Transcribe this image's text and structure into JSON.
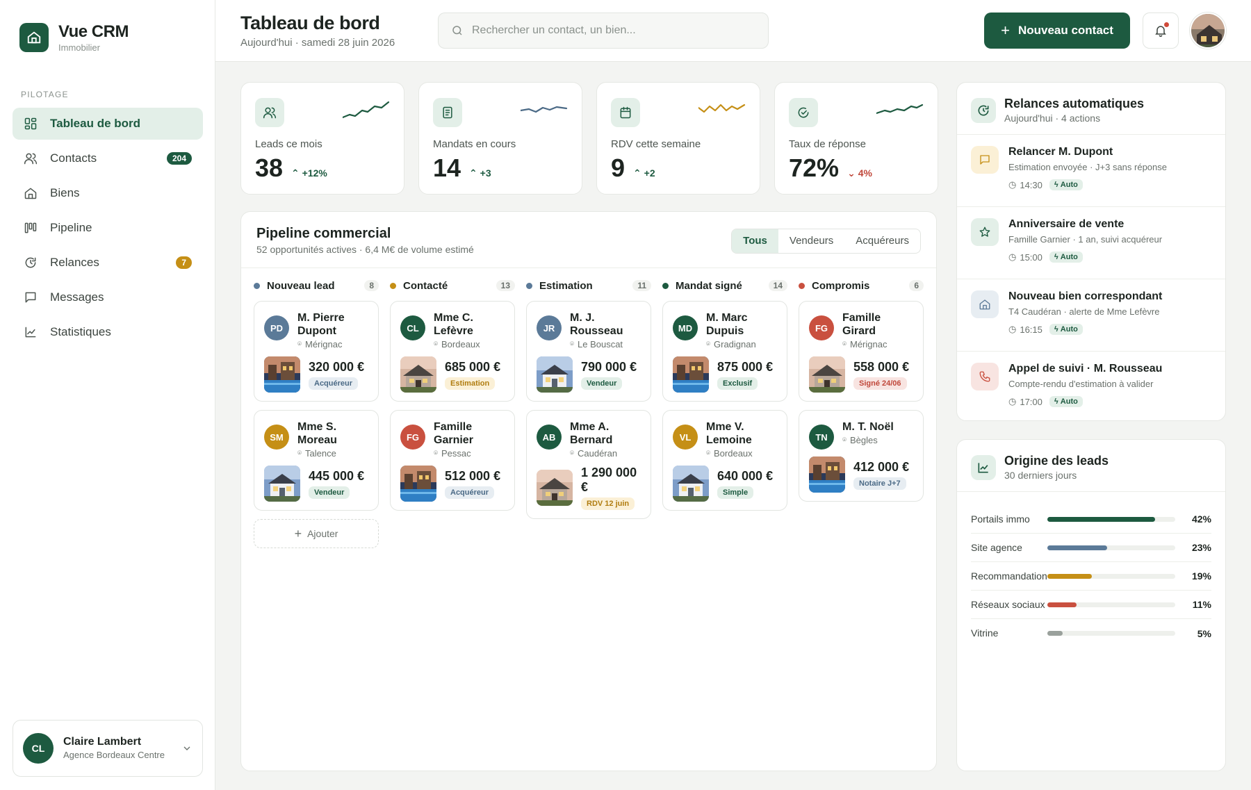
{
  "app": {
    "title": "Vue CRM",
    "subtitle": "Immobilier",
    "brand_color": "#1d5a40"
  },
  "sidebar": {
    "section": "PILOTAGE",
    "items": [
      {
        "label": "Tableau de bord",
        "icon": "dashboard-icon",
        "active": true
      },
      {
        "label": "Contacts",
        "icon": "users-icon",
        "badge": "204"
      },
      {
        "label": "Biens",
        "icon": "home-icon"
      },
      {
        "label": "Pipeline",
        "icon": "pipeline-icon"
      },
      {
        "label": "Relances",
        "icon": "clock-icon",
        "badge": "7"
      },
      {
        "label": "Messages",
        "icon": "message-icon"
      },
      {
        "label": "Statistiques",
        "icon": "chart-icon"
      }
    ],
    "user": {
      "initials": "CL",
      "name": "Claire Lambert",
      "org": "Agence Bordeaux Centre"
    }
  },
  "header": {
    "title": "Tableau de bord",
    "date": "Aujourd'hui · samedi 28 juin 2026",
    "search_placeholder": "Rechercher un contact, un bien...",
    "new_contact": "Nouveau contact"
  },
  "kpis": [
    {
      "label": "Leads ce mois",
      "value": "38",
      "delta": "+12%",
      "trend": "up",
      "icon": "users-icon",
      "spark_color": "#1d5a40"
    },
    {
      "label": "Mandats en cours",
      "value": "14",
      "delta": "+3",
      "trend": "up",
      "icon": "document-icon",
      "spark_color": "#4b6a86"
    },
    {
      "label": "RDV cette semaine",
      "value": "9",
      "delta": "+2",
      "trend": "up",
      "icon": "calendar-icon",
      "spark_color": "#c58f16"
    },
    {
      "label": "Taux de réponse",
      "value": "72%",
      "delta": "4%",
      "trend": "down",
      "icon": "check-circle-icon",
      "spark_color": "#1d5a40"
    }
  ],
  "pipeline": {
    "title": "Pipeline commercial",
    "subtitle": "52 opportunités actives · 6,4 M€ de volume estimé",
    "tabs": [
      "Tous",
      "Vendeurs",
      "Acquéreurs"
    ],
    "add_label": "Ajouter",
    "columns": [
      {
        "name": "Nouveau lead",
        "count": "8",
        "color": "#5b7a98",
        "deals": [
          {
            "initials": "PD",
            "av": "#5b7a98",
            "name": "M. Pierre Dupont",
            "loc": "Mérignac",
            "price": "320 000 €",
            "tag": "Acquéreur",
            "tag_style": "blue",
            "photo": "pool"
          },
          {
            "initials": "SM",
            "av": "#c58f16",
            "name": "Mme S. Moreau",
            "loc": "Talence",
            "price": "445 000 €",
            "tag": "Vendeur",
            "tag_style": "green",
            "photo": "house"
          }
        ]
      },
      {
        "name": "Contacté",
        "count": "13",
        "color": "#c58f16",
        "deals": [
          {
            "initials": "CL",
            "av": "#1d5a40",
            "name": "Mme C. Lefèvre",
            "loc": "Bordeaux",
            "price": "685 000 €",
            "tag": "Estimation",
            "tag_style": "amber",
            "photo": "house2"
          },
          {
            "initials": "FG",
            "av": "#c9503f",
            "name": "Famille Garnier",
            "loc": "Pessac",
            "price": "512 000 €",
            "tag": "Acquéreur",
            "tag_style": "blue",
            "photo": "pool"
          }
        ]
      },
      {
        "name": "Estimation",
        "count": "11",
        "color": "#5b7a98",
        "deals": [
          {
            "initials": "JR",
            "av": "#5b7a98",
            "name": "M. J. Rousseau",
            "loc": "Le Bouscat",
            "price": "790 000 €",
            "tag": "Vendeur",
            "tag_style": "green",
            "photo": "house"
          },
          {
            "initials": "AB",
            "av": "#1d5a40",
            "name": "Mme A. Bernard",
            "loc": "Caudéran",
            "price": "1 290 000 €",
            "tag": "RDV 12 juin",
            "tag_style": "amber",
            "photo": "house2"
          }
        ]
      },
      {
        "name": "Mandat signé",
        "count": "14",
        "color": "#1d5a40",
        "deals": [
          {
            "initials": "MD",
            "av": "#1d5a40",
            "name": "M. Marc Dupuis",
            "loc": "Gradignan",
            "price": "875 000 €",
            "tag": "Exclusif",
            "tag_style": "green",
            "photo": "pool"
          },
          {
            "initials": "VL",
            "av": "#c58f16",
            "name": "Mme V. Lemoine",
            "loc": "Bordeaux",
            "price": "640 000 €",
            "tag": "Simple",
            "tag_style": "green",
            "photo": "house"
          }
        ]
      },
      {
        "name": "Compromis",
        "count": "6",
        "color": "#c9503f",
        "deals": [
          {
            "initials": "FG",
            "av": "#c9503f",
            "name": "Famille Girard",
            "loc": "Mérignac",
            "price": "558 000 €",
            "tag": "Signé 24/06",
            "tag_style": "red",
            "photo": "house2"
          },
          {
            "initials": "TN",
            "av": "#1d5a40",
            "name": "M. T. Noël",
            "loc": "Bègles",
            "price": "412 000 €",
            "tag": "Notaire J+7",
            "tag_style": "blue",
            "photo": "pool"
          }
        ]
      }
    ]
  },
  "relances": {
    "title": "Relances automatiques",
    "subtitle": "Aujourd'hui · 4 actions",
    "items": [
      {
        "title": "Relancer M. Dupont",
        "desc": "Estimation envoyée · J+3 sans réponse",
        "time": "14:30",
        "badge": "Auto",
        "icon": "message-icon",
        "bg": "#fbf0d6",
        "fg": "#c58f16"
      },
      {
        "title": "Anniversaire de vente",
        "desc": "Famille Garnier · 1 an, suivi acquéreur",
        "time": "15:00",
        "badge": "Auto",
        "icon": "star-icon",
        "bg": "#e3efe8",
        "fg": "#1d5a40"
      },
      {
        "title": "Nouveau bien correspondant",
        "desc": "T4 Caudéran · alerte de Mme Lefèvre",
        "time": "16:15",
        "badge": "Auto",
        "icon": "home-icon",
        "bg": "#e7edf2",
        "fg": "#5b7a98"
      },
      {
        "title": "Appel de suivi · M. Rousseau",
        "desc": "Compte-rendu d'estimation à valider",
        "time": "17:00",
        "badge": "Auto",
        "icon": "phone-icon",
        "bg": "#f8e4e1",
        "fg": "#c9503f"
      }
    ]
  },
  "origin": {
    "title": "Origine des leads",
    "subtitle": "30 derniers jours",
    "rows": [
      {
        "label": "Portails immo",
        "pct": "42%",
        "value": 0.84,
        "color": "#1d5a40"
      },
      {
        "label": "Site agence",
        "pct": "23%",
        "value": 0.47,
        "color": "#5b7a98"
      },
      {
        "label": "Recommandation",
        "pct": "19%",
        "value": 0.35,
        "color": "#c58f16"
      },
      {
        "label": "Réseaux sociaux",
        "pct": "11%",
        "value": 0.23,
        "color": "#c9503f"
      },
      {
        "label": "Vitrine",
        "pct": "5%",
        "value": 0.12,
        "color": "#9aa19c"
      }
    ]
  }
}
